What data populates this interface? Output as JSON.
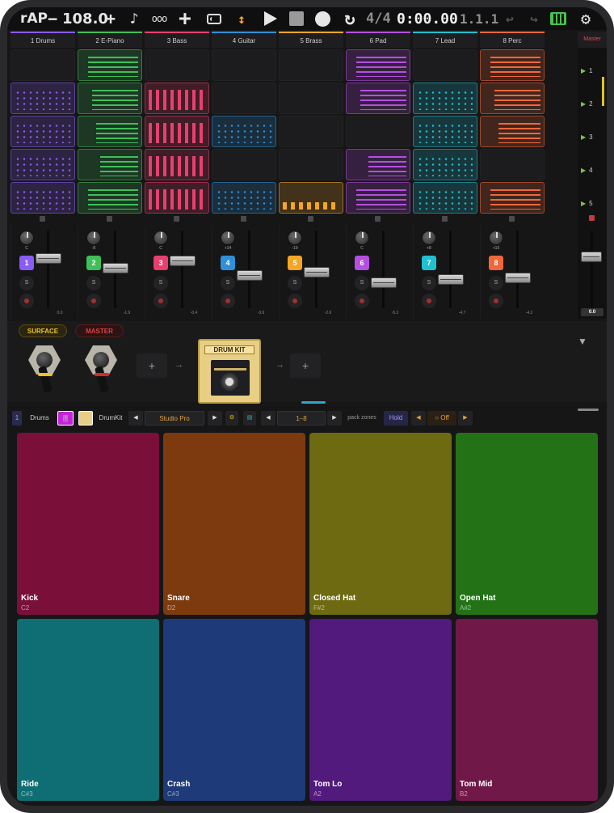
{
  "transport": {
    "app_name": "rAP",
    "tempo_minus": "−",
    "tempo": "108.0",
    "tempo_plus": "+",
    "time_signature": "4/4",
    "clock": "0:00.00",
    "position": "1.1.1",
    "icons": [
      "note-icon",
      "loop-icon",
      "add-icon",
      "tape-icon",
      "up-down-icon",
      "play-icon",
      "stop-icon",
      "record-icon",
      "cycle-icon",
      "undo-icon",
      "redo-icon",
      "keyboard-icon",
      "gear-icon"
    ]
  },
  "tracks": [
    {
      "label": "1 Drums",
      "color": "#8a5cf6"
    },
    {
      "label": "2 E-Piano",
      "color": "#3fbf5a"
    },
    {
      "label": "3 Bass",
      "color": "#e83f6f"
    },
    {
      "label": "4 Guitar",
      "color": "#2f8fd8"
    },
    {
      "label": "5 Brass",
      "color": "#f5a623"
    },
    {
      "label": "6 Pad",
      "color": "#b54fe0"
    },
    {
      "label": "7 Lead",
      "color": "#20c0d0"
    },
    {
      "label": "8 Perc",
      "color": "#f0683a"
    }
  ],
  "master": {
    "label": "Master",
    "db": "0.0"
  },
  "scenes": [
    "1",
    "2",
    "3",
    "4",
    "5"
  ],
  "mixer": [
    {
      "num": "1",
      "knob": "C",
      "solo": "S",
      "db": "0.0",
      "level": 0.82
    },
    {
      "num": "2",
      "knob": "-8",
      "solo": "S",
      "db": "-1.9",
      "level": 0.68
    },
    {
      "num": "3",
      "knob": "C",
      "solo": "S",
      "db": "-0.4",
      "level": 0.78
    },
    {
      "num": "4",
      "knob": "+14",
      "solo": "S",
      "db": "-3.6",
      "level": 0.58
    },
    {
      "num": "5",
      "knob": "-19",
      "solo": "S",
      "db": "-2.6",
      "level": 0.62
    },
    {
      "num": "6",
      "knob": "C",
      "solo": "S",
      "db": "-5.2",
      "level": 0.48
    },
    {
      "num": "7",
      "knob": "+8",
      "solo": "S",
      "db": "-4.7",
      "level": 0.52
    },
    {
      "num": "8",
      "knob": "+15",
      "solo": "S",
      "db": "-4.2",
      "level": 0.55
    }
  ],
  "chain": {
    "surface_label": "SURFACE",
    "master_label": "MASTER",
    "add": "+",
    "arrow": "→",
    "instrument_title": "DRUM KIT",
    "collapse": "▼"
  },
  "instrument_bar": {
    "track_num": "1",
    "track_name": "Drums",
    "kit_name": "DrumKit",
    "prev": "◀",
    "next": "▶",
    "preset": "Studio Pro",
    "zone_range": "1–8",
    "pack_zones": "pack zones",
    "hold": "Hold",
    "latch_prev": "◀",
    "latch_next": "▶",
    "latch_value": "○ Off",
    "gear_small": "⚙",
    "doc_small": "▤"
  },
  "pads": [
    {
      "name": "Kick",
      "note": "C2",
      "color": "#7a0f3a"
    },
    {
      "name": "Snare",
      "note": "D2",
      "color": "#7c3a0e"
    },
    {
      "name": "Closed Hat",
      "note": "F#2",
      "color": "#6e6a12"
    },
    {
      "name": "Open Hat",
      "note": "A#2",
      "color": "#237316"
    },
    {
      "name": "Ride",
      "note": "C#3",
      "color": "#0e6e74"
    },
    {
      "name": "Crash",
      "note": "C#3",
      "color": "#1e3a78"
    },
    {
      "name": "Tom Lo",
      "note": "A2",
      "color": "#521a7c"
    },
    {
      "name": "Tom Mid",
      "note": "B2",
      "color": "#701848"
    }
  ]
}
